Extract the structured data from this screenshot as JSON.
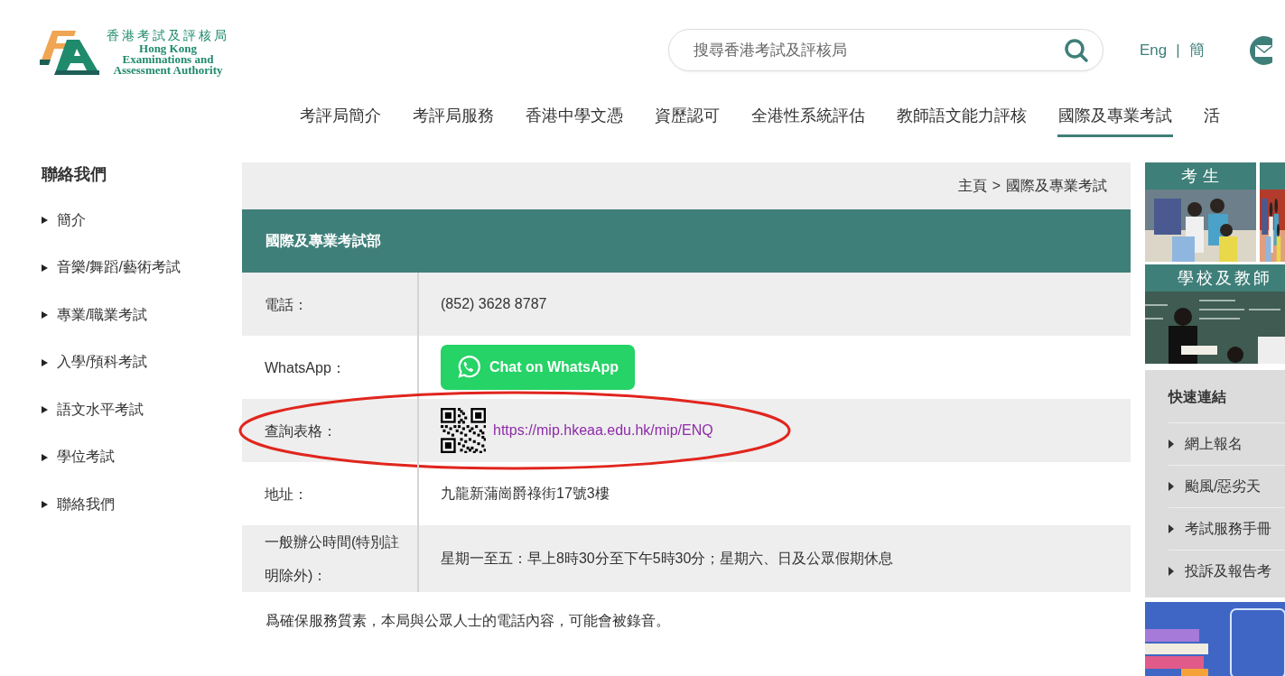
{
  "header": {
    "logo": {
      "chinese_name": "香港考試及評核局",
      "english_lines": [
        "Hong Kong",
        "Examinations and",
        "Assessment Authority"
      ]
    },
    "search": {
      "placeholder": "搜尋香港考試及評核局"
    },
    "languages": [
      "Eng",
      "簡"
    ],
    "language_separator": "|"
  },
  "nav": [
    {
      "label": "考評局簡介",
      "selected": false
    },
    {
      "label": "考評局服務",
      "selected": false
    },
    {
      "label": "香港中學文憑",
      "selected": false
    },
    {
      "label": "資歷認可",
      "selected": false
    },
    {
      "label": "全港性系統評估",
      "selected": false
    },
    {
      "label": "教師語文能力評核",
      "selected": false
    },
    {
      "label": "國際及專業考試",
      "selected": true
    },
    {
      "label": "活",
      "selected": false
    }
  ],
  "sidebar": {
    "title": "聯絡我們",
    "items": [
      "簡介",
      "音樂/舞蹈/藝術考試",
      "專業/職業考試",
      "入學/預科考試",
      "語文水平考試",
      "學位考試",
      "聯絡我們"
    ]
  },
  "breadcrumb": {
    "items": [
      "主頁",
      "國際及專業考試"
    ],
    "separator": ">"
  },
  "contact": {
    "title": "國際及專業考試部",
    "rows": [
      {
        "label": "電話：",
        "kind": "text",
        "value": "(852) 3628 8787"
      },
      {
        "label": "WhatsApp：",
        "kind": "button",
        "value": "Chat on WhatsApp"
      },
      {
        "label": "查詢表格：",
        "kind": "link",
        "value": "https://mip.hkeaa.edu.hk/mip/ENQ",
        "highlighted": true
      },
      {
        "label": "地址：",
        "kind": "text",
        "value": "九龍新蒲崗爵祿街17號3樓"
      },
      {
        "label": "一般辦公時間(特別註明除外)：",
        "kind": "text",
        "value": "星期一至五：早上8時30分至下午5時30分；星期六、日及公眾假期休息"
      }
    ],
    "note": "爲確保服務質素，本局與公眾人士的電話內容，可能會被錄音。"
  },
  "aside": {
    "cards": [
      {
        "kind": "titled",
        "title": "考生"
      },
      {
        "kind": "picture"
      },
      {
        "kind": "titled",
        "title": "學校及教師"
      }
    ],
    "quick_links": {
      "title": "快速連結",
      "items": [
        "網上報名",
        "颱風/惡劣天",
        "考試服務手冊",
        "投訴及報告考"
      ]
    },
    "banner": {
      "kind": "picture"
    }
  }
}
